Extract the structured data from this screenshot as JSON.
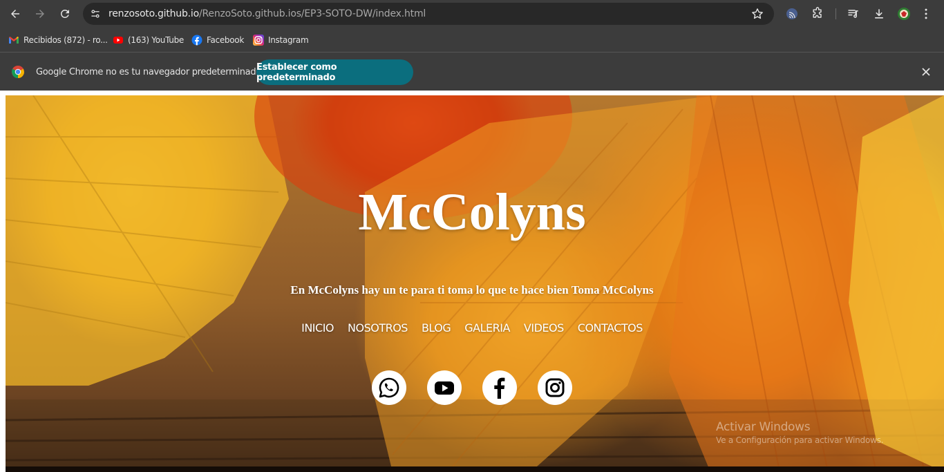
{
  "browser": {
    "url_host": "renzosoto.github.io",
    "url_path": "/RenzoSoto.github.ios/EP3-SOTO-DW/index.html",
    "bookmarks": [
      {
        "label": "Recibidos (872) - ro...",
        "icon": "gmail-icon"
      },
      {
        "label": "(163) YouTube",
        "icon": "youtube-icon"
      },
      {
        "label": "Facebook",
        "icon": "facebook-icon"
      },
      {
        "label": "Instagram",
        "icon": "instagram-icon"
      }
    ],
    "infobar": {
      "message": "Google Chrome no es tu navegador predeterminado",
      "button_label": "Establecer como predeterminado"
    }
  },
  "page": {
    "title": "McColyns",
    "tagline": "En McColyns hay un te para ti toma lo que te hace bien Toma McColyns",
    "nav": [
      "INICIO",
      "NOSOTROS",
      "BLOG",
      "GALERIA",
      "VIDEOS",
      "CONTACTOS"
    ],
    "social": [
      "whatsapp-icon",
      "youtube-icon",
      "facebook-icon",
      "instagram-icon"
    ]
  },
  "watermark": {
    "title": "Activar Windows",
    "subtitle": "Ve a Configuración para activar Windows."
  },
  "colors": {
    "chrome_bg": "#3c3c3c",
    "omnibox_bg": "#282828",
    "infobar_button": "#0b6e7e",
    "hero_text": "#ffffff"
  }
}
